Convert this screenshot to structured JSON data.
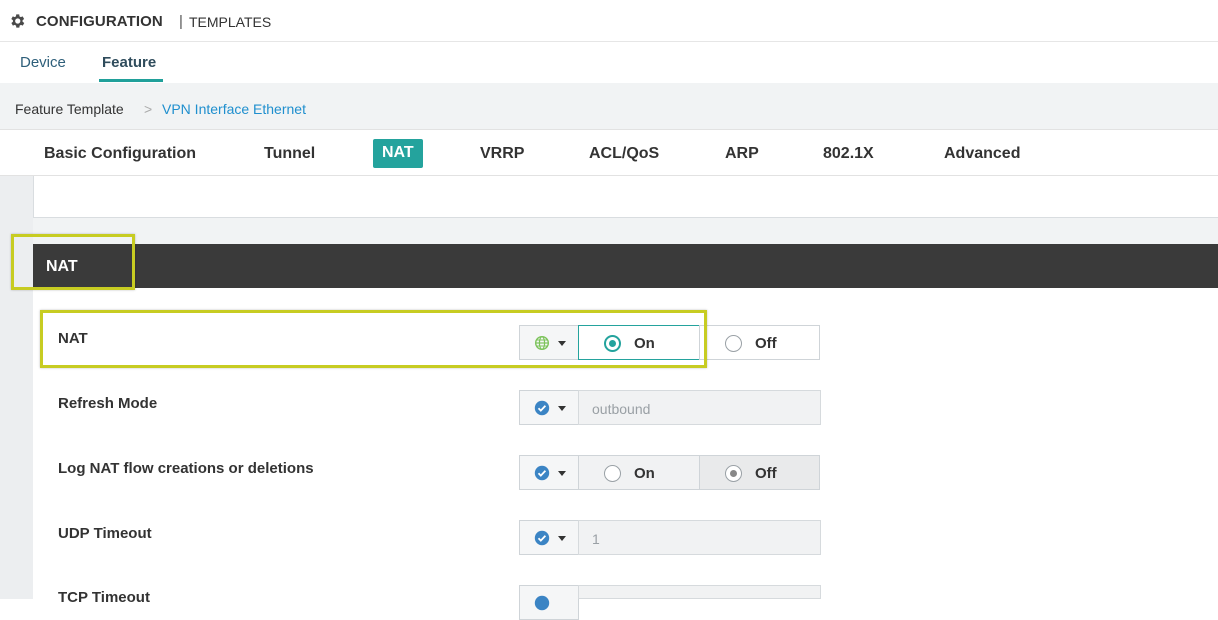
{
  "topbar": {
    "title": "CONFIGURATION",
    "separator": "|",
    "subtitle": "TEMPLATES",
    "icon": "gear-icon"
  },
  "subtabs": [
    {
      "label": "Device",
      "active": false
    },
    {
      "label": "Feature",
      "active": true
    }
  ],
  "breadcrumb": {
    "root": "Feature Template",
    "arrow": ">",
    "leaf": "VPN Interface Ethernet"
  },
  "section_tabs": [
    {
      "label": "Basic Configuration",
      "active": false
    },
    {
      "label": "Tunnel",
      "active": false
    },
    {
      "label": "NAT",
      "active": true
    },
    {
      "label": "VRRP",
      "active": false
    },
    {
      "label": "ACL/QoS",
      "active": false
    },
    {
      "label": "ARP",
      "active": false
    },
    {
      "label": "802.1X",
      "active": false
    },
    {
      "label": "Advanced",
      "active": false
    }
  ],
  "section_header": "NAT",
  "fields": [
    {
      "label": "NAT",
      "scope_icon": "globe-icon",
      "type": "radio",
      "on": "On",
      "off": "Off",
      "selected": "On"
    },
    {
      "label": "Refresh Mode",
      "scope_icon": "check-circle-icon",
      "type": "text",
      "value": "outbound"
    },
    {
      "label": "Log NAT flow creations or deletions",
      "scope_icon": "check-circle-icon",
      "type": "radio",
      "on": "On",
      "off": "Off",
      "selected": "Off"
    },
    {
      "label": "UDP Timeout",
      "scope_icon": "check-circle-icon",
      "type": "text",
      "value": "1"
    },
    {
      "label": "TCP Timeout",
      "scope_icon": "check-circle-icon",
      "type": "text",
      "value": ""
    }
  ],
  "colors": {
    "accent": "#24a39d",
    "link": "#1f8fce",
    "header_bg": "#3a3a3a",
    "highlight": "#c7cc22"
  }
}
